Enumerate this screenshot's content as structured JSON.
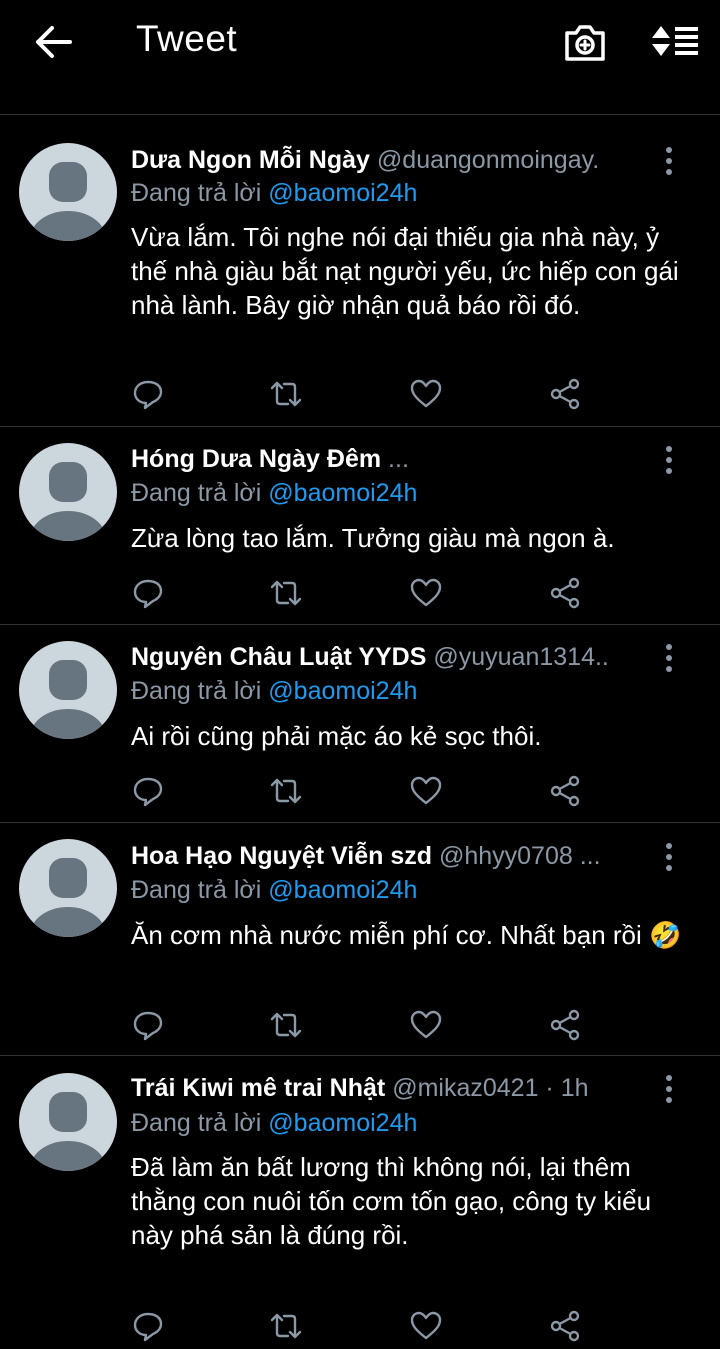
{
  "header": {
    "title": "Tweet",
    "back_icon": "arrow-left-icon",
    "camera_icon": "camera-add-icon",
    "sort_icon": "sort-icon"
  },
  "colors": {
    "background": "#000000",
    "accent": "#1d9bf0",
    "secondary_text": "#8b98a5",
    "icon": "#8b98a5"
  },
  "tweets": [
    {
      "name": "Dưa Ngon Mỗi Ngày",
      "handle": "@duangonmoingay.",
      "reply_label": "Đang trả lời",
      "reply_to": "@baomoi24h",
      "text": "Vừa lắm. Tôi nghe nói đại thiếu gia nhà này, ỷ thế nhà giàu bắt nạt người yếu, ức hiếp con gái nhà lành. Bây giờ nhận quả báo rồi đó."
    },
    {
      "name": "Hóng Dưa Ngày Đêm",
      "handle": "...",
      "reply_label": "Đang trả lời",
      "reply_to": "@baomoi24h",
      "text": "Zừa lòng tao lắm. Tưởng giàu mà ngon à."
    },
    {
      "name": "Nguyên Châu Luật YYDS",
      "handle": "@yuyuan1314..",
      "reply_label": "Đang trả lời",
      "reply_to": "@baomoi24h",
      "text": "Ai rồi cũng phải mặc áo kẻ sọc thôi."
    },
    {
      "name": "Hoa Hạo Nguyệt Viễn szd",
      "handle": "@hhyy0708 ...",
      "reply_label": "Đang trả lời",
      "reply_to": "@baomoi24h",
      "text": "Ăn cơm nhà nước miễn phí cơ. Nhất bạn rồi 🤣"
    },
    {
      "name": "Trái Kiwi mê trai Nhật",
      "handle": "@mikaz0421 · 1h",
      "reply_label": "Đang trả lời",
      "reply_to": "@baomoi24h",
      "text": "Đã làm ăn bất lương thì không nói, lại thêm thằng con nuôi tốn cơm tốn gạo, công ty kiểu này phá sản là đúng rồi."
    }
  ]
}
